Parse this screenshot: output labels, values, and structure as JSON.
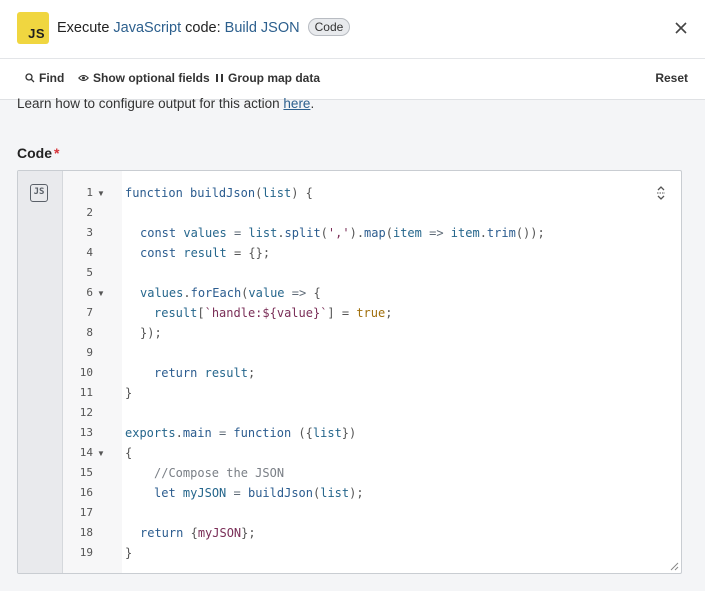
{
  "header": {
    "app_icon_text": "JS",
    "title_prefix": "Execute ",
    "title_link": "JavaScript",
    "title_mid": " code: ",
    "title_action": "Build JSON",
    "badge": "Code"
  },
  "toolbar": {
    "find": "Find",
    "show_optional": "Show optional fields",
    "group_map": "Group map data",
    "reset": "Reset"
  },
  "help": {
    "text": "Learn how to configure output for this action ",
    "link": "here",
    "end": "."
  },
  "field": {
    "label": "Code",
    "required_mark": "*",
    "editor_icon": "JS"
  },
  "code_lines": [
    {
      "n": "1",
      "fold": true
    },
    {
      "n": "2"
    },
    {
      "n": "3"
    },
    {
      "n": "4"
    },
    {
      "n": "5"
    },
    {
      "n": "6",
      "fold": true
    },
    {
      "n": "7"
    },
    {
      "n": "8"
    },
    {
      "n": "9"
    },
    {
      "n": "10"
    },
    {
      "n": "11"
    },
    {
      "n": "12"
    },
    {
      "n": "13"
    },
    {
      "n": "14",
      "fold": true
    },
    {
      "n": "15"
    },
    {
      "n": "16"
    },
    {
      "n": "17"
    },
    {
      "n": "18"
    },
    {
      "n": "19"
    }
  ],
  "code": {
    "l1_kw": "function",
    "l1_fn": "buildJson",
    "l1_p1": "(",
    "l1_arg": "list",
    "l1_p2": ") {",
    "l3_kw": "const",
    "l3_v": "values",
    "l3_eq": " = ",
    "l3_list": "list",
    "l3_d1": ".",
    "l3_split": "split",
    "l3_p1": "(",
    "l3_str": "','",
    "l3_p2": ").",
    "l3_map": "map",
    "l3_p3": "(",
    "l3_item": "item",
    "l3_arrow": " => ",
    "l3_item2": "item",
    "l3_d2": ".",
    "l3_trim": "trim",
    "l3_end": "());",
    "l4_kw": "const",
    "l4_v": "result",
    "l4_rest": " = {};",
    "l6_v": "values",
    "l6_d": ".",
    "l6_fe": "forEach",
    "l6_p1": "(",
    "l6_arg": "value",
    "l6_arrow": " => ",
    "l6_end": "{",
    "l7_v": "result",
    "l7_p1": "[",
    "l7_str": "`handle:${value}`",
    "l7_p2": "] = ",
    "l7_bool": "true",
    "l7_end": ";",
    "l8": "});",
    "l10_kw": "return",
    "l10_v": "result",
    "l10_end": ";",
    "l11": "}",
    "l13_obj": "exports",
    "l13_d": ".",
    "l13_main": "main",
    "l13_eq": " = ",
    "l13_kw": "function",
    "l13_p1": " ({",
    "l13_arg": "list",
    "l13_p2": "})",
    "l14": "{",
    "l15": "//Compose the JSON",
    "l16_kw": "let",
    "l16_v": "myJSON",
    "l16_eq": " = ",
    "l16_fn": "buildJson",
    "l16_p1": "(",
    "l16_arg": "list",
    "l16_end": ");",
    "l18_kw": "return",
    "l18_p1": " {",
    "l18_v": "myJSON",
    "l18_end": "};",
    "l19": "}"
  }
}
